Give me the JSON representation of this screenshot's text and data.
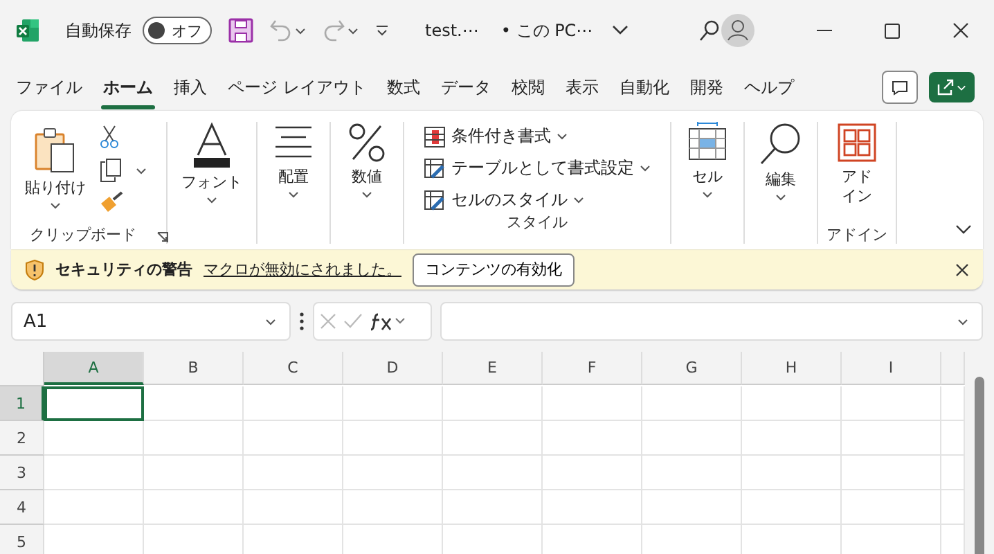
{
  "title_bar": {
    "autosave_label": "自動保存",
    "autosave_toggle": {
      "label": "オフ",
      "on": false
    },
    "file_name": "test.⋯",
    "location": "• この PC⋯"
  },
  "tabs": [
    {
      "label": "ファイル",
      "selected": false
    },
    {
      "label": "ホーム",
      "selected": true
    },
    {
      "label": "挿入",
      "selected": false
    },
    {
      "label": "ページ レイアウト",
      "selected": false
    },
    {
      "label": "数式",
      "selected": false
    },
    {
      "label": "データ",
      "selected": false
    },
    {
      "label": "校閲",
      "selected": false
    },
    {
      "label": "表示",
      "selected": false
    },
    {
      "label": "自動化",
      "selected": false
    },
    {
      "label": "開発",
      "selected": false
    },
    {
      "label": "ヘルプ",
      "selected": false
    }
  ],
  "ribbon": {
    "groups": [
      {
        "kind": "clipboard",
        "button": "貼り付け",
        "label": "クリップボード"
      },
      {
        "kind": "font",
        "button": "フォント"
      },
      {
        "kind": "alignment",
        "button": "配置"
      },
      {
        "kind": "number",
        "button": "数値"
      },
      {
        "kind": "styles",
        "items": [
          "条件付き書式",
          "テーブルとして書式設定",
          "セルのスタイル"
        ],
        "label": "スタイル"
      },
      {
        "kind": "cells",
        "button": "セル"
      },
      {
        "kind": "editing",
        "button": "編集"
      },
      {
        "kind": "addins",
        "button": "アドイン",
        "label": "アドイン"
      }
    ]
  },
  "message_bar": {
    "title": "セキュリティの警告",
    "message": "マクロが無効にされました。",
    "button": "コンテンツの有効化"
  },
  "formula_bar": {
    "name_box": "A1"
  },
  "grid": {
    "columns": [
      {
        "label": "A",
        "selected": true
      },
      {
        "label": "B",
        "selected": false
      },
      {
        "label": "C",
        "selected": false
      },
      {
        "label": "D",
        "selected": false
      },
      {
        "label": "E",
        "selected": false
      },
      {
        "label": "F",
        "selected": false
      },
      {
        "label": "G",
        "selected": false
      },
      {
        "label": "H",
        "selected": false
      },
      {
        "label": "I",
        "selected": false
      }
    ],
    "rows": [
      {
        "label": "1",
        "selected": true
      },
      {
        "label": "2",
        "selected": false
      },
      {
        "label": "3",
        "selected": false
      },
      {
        "label": "4",
        "selected": false
      },
      {
        "label": "5",
        "selected": false
      }
    ]
  }
}
